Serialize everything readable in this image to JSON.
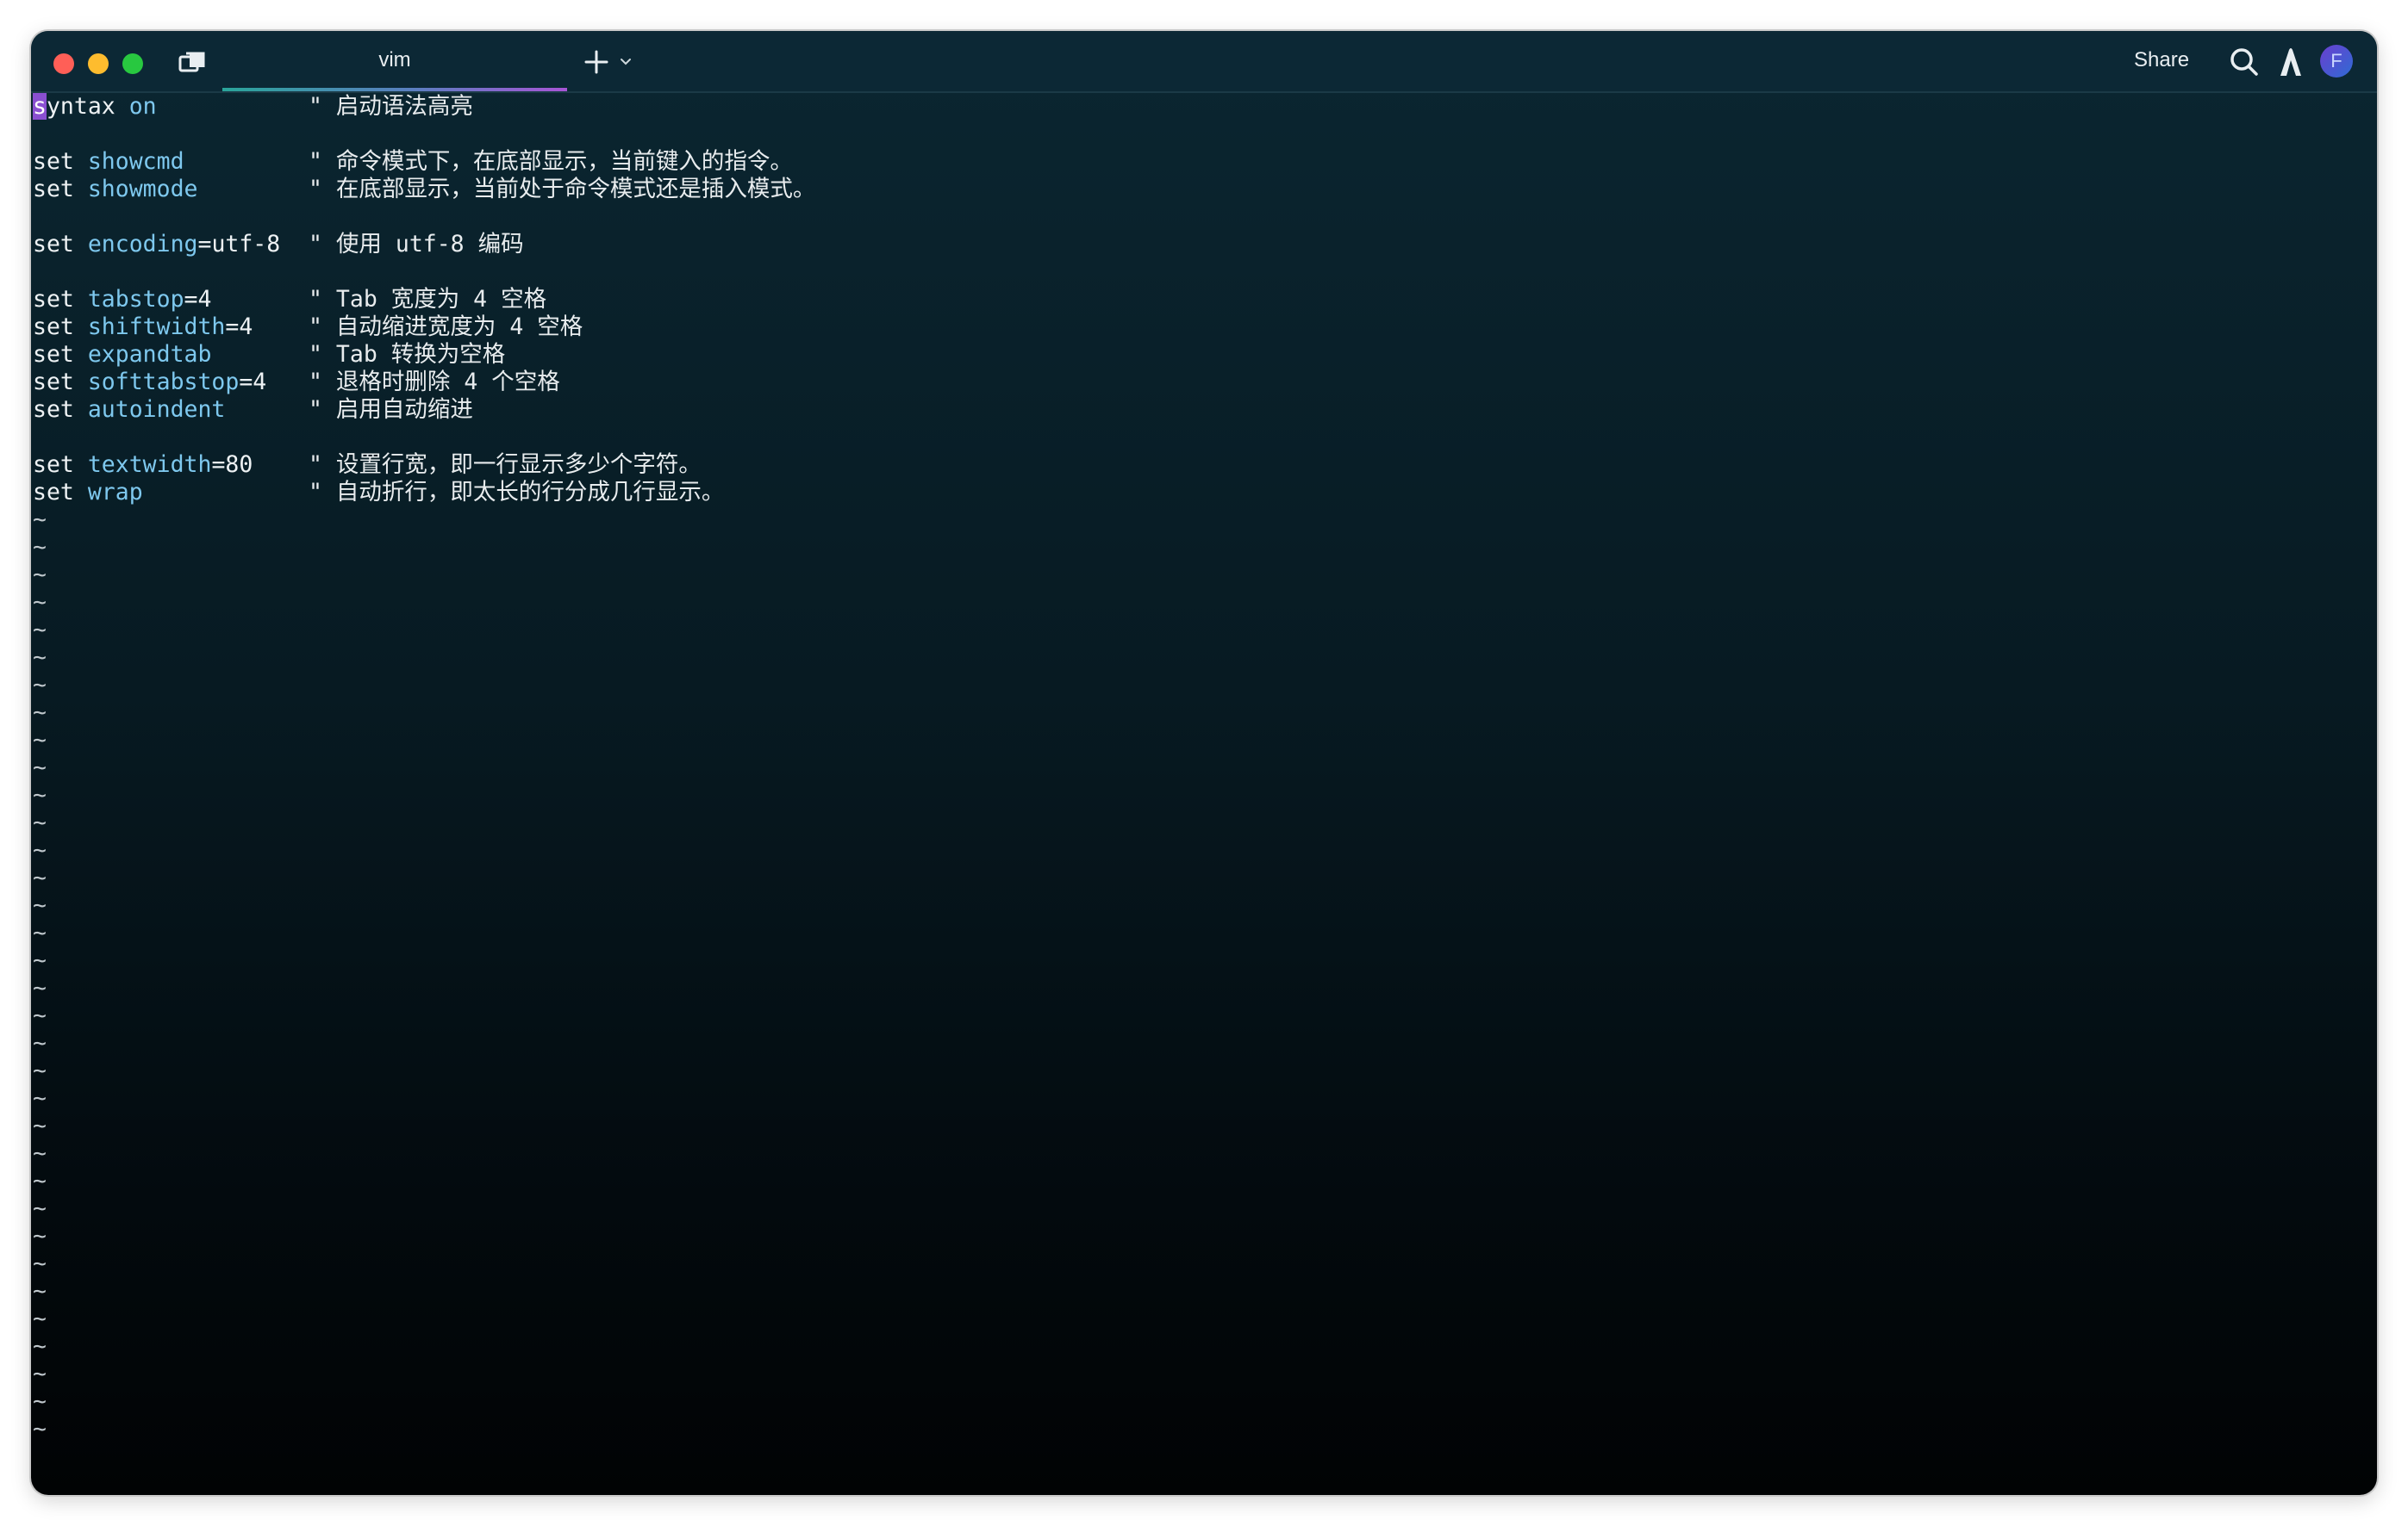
{
  "window": {
    "tab_title": "vim",
    "share_label": "Share",
    "avatar_letter": "F",
    "icons": [
      "book-icon",
      "plus-icon",
      "chevron-down-icon",
      "search-icon",
      "brand-icon"
    ]
  },
  "editor": {
    "cursor_char": "s",
    "first_line_rest": "yntax",
    "first_line_on": "on",
    "first_line_comment": "\" 启动语法高亮",
    "lines": [
      {
        "kw": "set",
        "opt": "showcmd",
        "rest": "",
        "comment": "\" 命令模式下，在底部显示，当前键入的指令。"
      },
      {
        "kw": "set",
        "opt": "showmode",
        "rest": "",
        "comment": "\" 在底部显示，当前处于命令模式还是插入模式。"
      },
      {
        "kw": "set",
        "opt": "encoding",
        "rest": "=utf-8",
        "comment": "\" 使用 utf-8 编码"
      },
      {
        "kw": "set",
        "opt": "tabstop",
        "rest": "=4",
        "comment": "\" Tab 宽度为 4 空格"
      },
      {
        "kw": "set",
        "opt": "shiftwidth",
        "rest": "=4",
        "comment": "\" 自动缩进宽度为 4 空格"
      },
      {
        "kw": "set",
        "opt": "expandtab",
        "rest": "",
        "comment": "\" Tab 转换为空格"
      },
      {
        "kw": "set",
        "opt": "softtabstop",
        "rest": "=4",
        "comment": "\" 退格时删除 4 个空格"
      },
      {
        "kw": "set",
        "opt": "autoindent",
        "rest": "",
        "comment": "\" 启用自动缩进"
      },
      {
        "kw": "set",
        "opt": "textwidth",
        "rest": "=80",
        "comment": "\" 设置行宽，即一行显示多少个字符。"
      },
      {
        "kw": "set",
        "opt": "wrap",
        "rest": "",
        "comment": "\" 自动折行，即太长的行分成几行显示。"
      }
    ],
    "empty_marker": "~",
    "empty_line_count": 34
  }
}
